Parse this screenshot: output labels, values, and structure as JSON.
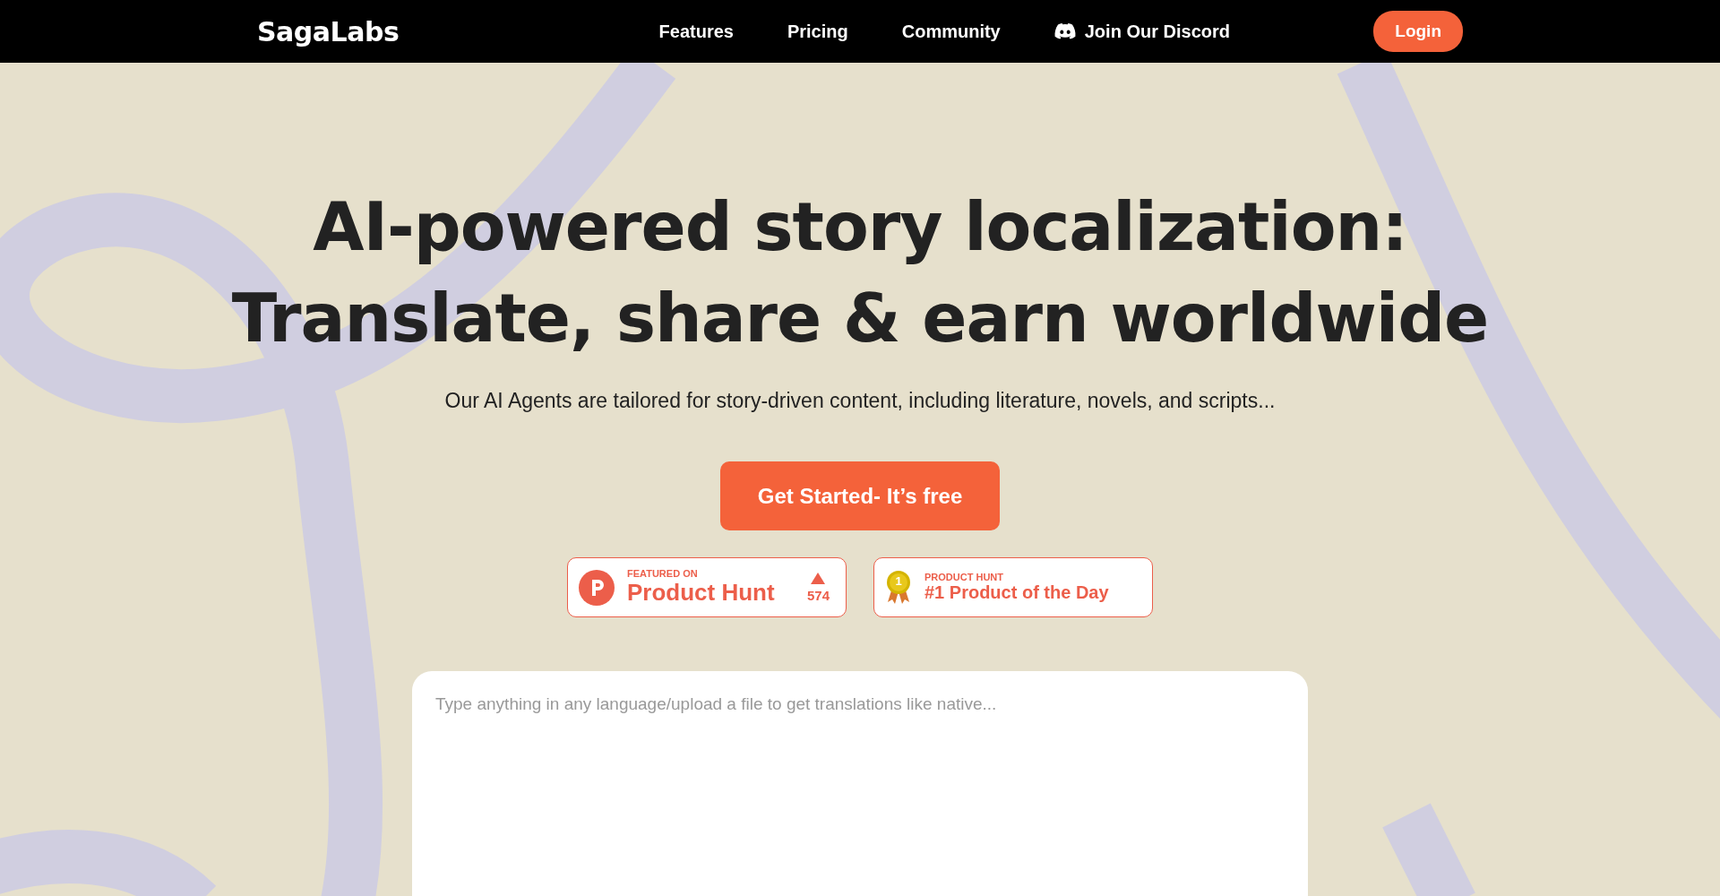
{
  "nav": {
    "logo": "SagaLabs",
    "links": [
      {
        "label": "Features",
        "kind": "text"
      },
      {
        "label": "Pricing",
        "kind": "text"
      },
      {
        "label": "Community",
        "kind": "text"
      },
      {
        "label": "Join Our Discord",
        "kind": "discord"
      }
    ],
    "login": "Login"
  },
  "hero": {
    "title_lines": [
      "AI-powered story localization:",
      "Translate, share & earn worldwide"
    ],
    "subtitle": "Our AI Agents are tailored for story-driven content, including literature, novels, and scripts...",
    "cta": "Get Started- It’s free"
  },
  "badges": [
    {
      "kind": "featured",
      "eyebrow": "FEATURED ON",
      "title": "Product Hunt",
      "count": "574"
    },
    {
      "kind": "award",
      "eyebrow": "PRODUCT HUNT",
      "title": "#1 Product of the Day",
      "medal": "1"
    }
  ],
  "translator": {
    "placeholder": "Type anything in any language/upload a file to get translations like native..."
  }
}
